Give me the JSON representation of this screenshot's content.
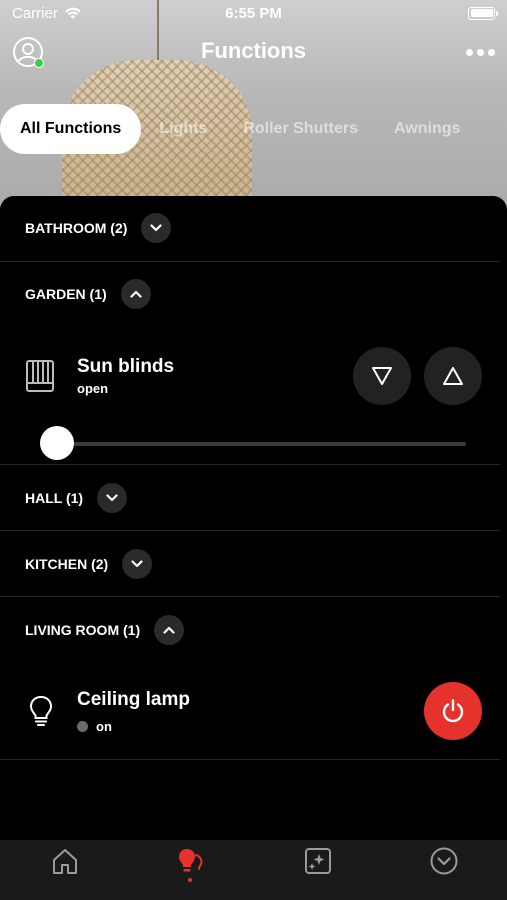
{
  "status_bar": {
    "carrier": "Carrier",
    "time": "6:55 PM"
  },
  "nav": {
    "title": "Functions"
  },
  "tabs": [
    {
      "label": "All Functions",
      "active": true
    },
    {
      "label": "Lights",
      "active": false
    },
    {
      "label": "Roller Shutters",
      "active": false
    },
    {
      "label": "Awnings",
      "active": false
    }
  ],
  "groups": [
    {
      "label": "BATHROOM (2)",
      "expanded": false
    },
    {
      "label": "GARDEN (1)",
      "expanded": true
    },
    {
      "label": "HALL (1)",
      "expanded": false
    },
    {
      "label": "KITCHEN (2)",
      "expanded": false
    },
    {
      "label": "LIVING ROOM (1)",
      "expanded": true
    }
  ],
  "devices": {
    "sun_blinds": {
      "name": "Sun blinds",
      "state": "open",
      "position_percent": 0,
      "icon": "blinds-icon"
    },
    "ceiling_lamp": {
      "name": "Ceiling lamp",
      "state": "on",
      "icon": "lightbulb-icon"
    }
  },
  "colors": {
    "accent": "#e5322d",
    "online": "#3ad04b",
    "background": "#000000"
  },
  "tabbar": [
    {
      "icon": "home-icon",
      "active": false
    },
    {
      "icon": "functions-icon",
      "active": true
    },
    {
      "icon": "scenes-icon",
      "active": false
    },
    {
      "icon": "more-icon",
      "active": false
    }
  ]
}
